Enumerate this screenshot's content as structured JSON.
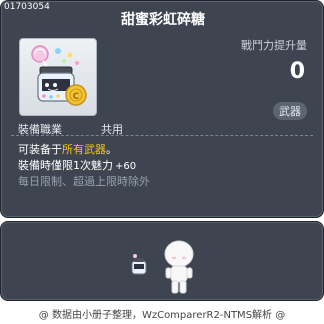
{
  "item": {
    "id": "01703054",
    "name": "甜蜜彩虹碎糖",
    "attack_label": "戰鬥力提升量",
    "attack_value": "0",
    "category_badge": "武器",
    "job_label": "裝備職業",
    "job_value": "共用",
    "desc_line1_prefix": "可装备于",
    "desc_line1_highlight": "所有武器",
    "desc_line1_suffix": "。",
    "desc_line2_text": "裝備時僅限1次魅力",
    "desc_line2_stat": "+60",
    "desc_line3": "每日限制、超過上限時除外"
  },
  "footer": {
    "credit": "@ 数据由小册子整理，WzComparerR2-NTMS解析 @"
  },
  "colors": {
    "panel": "#3e4550",
    "highlight": "#f5c518",
    "muted_text": "#9aa1ab"
  }
}
